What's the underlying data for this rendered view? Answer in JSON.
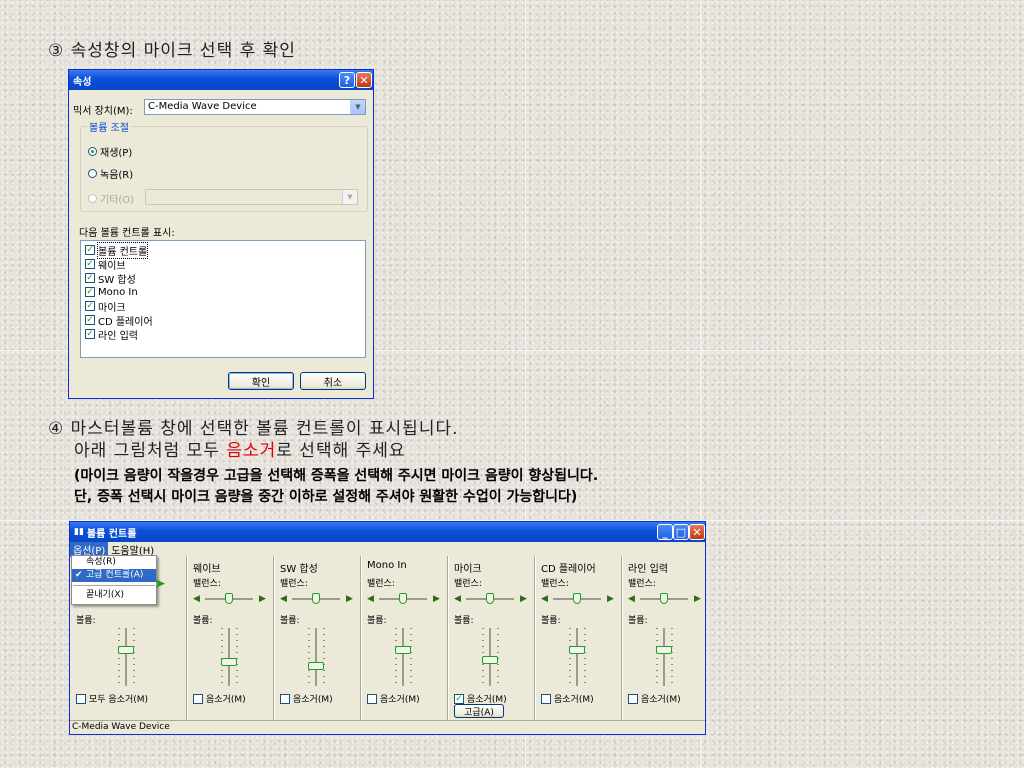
{
  "step3": {
    "text": "③ 속성창의 마이크 선택 후 확인"
  },
  "props": {
    "title": "속성",
    "help_btn": "?",
    "close_btn": "✕",
    "mixer_label": "믹서 장치(M):",
    "mixer_value": "C-Media Wave Device",
    "group_label": "볼륨 조절",
    "radio_play": "재생(P)",
    "radio_record": "녹음(R)",
    "radio_other": "기타(O)",
    "show_label": "다음 볼륨 컨트롤 표시:",
    "items": [
      "볼륨 컨트롤",
      "웨이브",
      "SW 합성",
      "Mono In",
      "마이크",
      "CD 플레이어",
      "라인 입력"
    ],
    "ok": "확인",
    "cancel": "취소"
  },
  "step4": {
    "line1": "④ 마스터볼륨 창에 선택한 볼륨 컨트롤이 표시됩니다.",
    "line2_a": "아래 그림처럼 모두 ",
    "line2_red": "음소거",
    "line2_b": "로 선택해 주세요",
    "note1": "(마이크 음량이 작을경우 고급을 선택해 증폭을 선택해 주시면 마이크 음량이 향상됩니다.",
    "note2": "단, 증폭 선택시 마이크 음량을 중간 이하로 설정해 주셔야 원활한 수업이 가능합니다)",
    "red_color": "#e00000"
  },
  "vol": {
    "title": "볼륨 컨트롤",
    "menu": [
      "옵션(P)",
      "도움말(H)"
    ],
    "dropdown": [
      "속성(R)",
      "고급 컨트롤(A)",
      "끝내기(X)"
    ],
    "balance": "밸런스:",
    "volume": "볼륨:",
    "master_mute": "모두 음소거(M)",
    "mute": "음소거(M)",
    "advanced": "고급(A)",
    "status": "C-Media Wave Device",
    "columns": [
      "웨이브",
      "SW 합성",
      "Mono In",
      "마이크",
      "CD 플레이어",
      "라인 입력"
    ],
    "mute_checked": [
      false,
      false,
      false,
      true,
      false,
      false
    ],
    "master_mute_checked": false
  }
}
